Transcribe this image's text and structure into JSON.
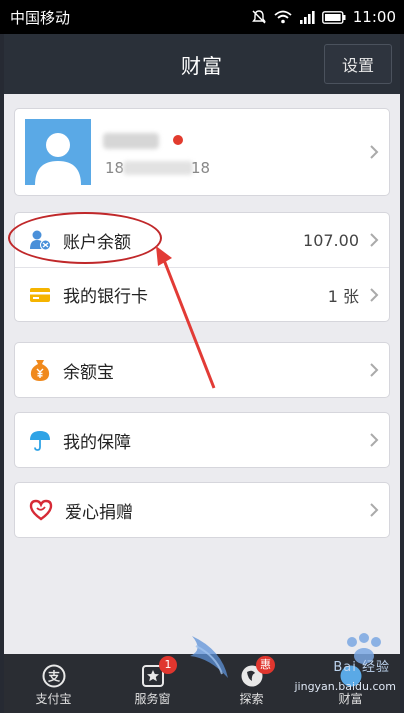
{
  "status_bar": {
    "carrier": "中国移动",
    "time": "11:00"
  },
  "header": {
    "title": "财富",
    "settings_label": "设置"
  },
  "profile": {
    "phone_prefix": "18",
    "phone_suffix": "18"
  },
  "account_card": {
    "items": [
      {
        "label": "账户余额",
        "value": "107.00",
        "icon": "account-balance-icon"
      },
      {
        "label": "我的银行卡",
        "value": "1 张",
        "icon": "bank-card-icon"
      }
    ]
  },
  "single_items": [
    {
      "label": "余额宝",
      "icon": "yuebao-money-bag-icon"
    },
    {
      "label": "我的保障",
      "icon": "umbrella-icon"
    },
    {
      "label": "爱心捐赠",
      "icon": "heart-icon"
    }
  ],
  "tab_bar": {
    "tabs": [
      {
        "label": "支付宝",
        "icon": "alipay-icon"
      },
      {
        "label": "服务窗",
        "icon": "service-window-icon",
        "badge": "1"
      },
      {
        "label": "探索",
        "icon": "explore-icon",
        "badge": "惠"
      },
      {
        "label": "财富",
        "icon": "wealth-icon"
      }
    ]
  },
  "watermark": {
    "text": "Bai 经验",
    "domain": "jingyan.baidu.com"
  },
  "colors": {
    "accent_blue": "#5aa9e6",
    "title_bar": "#2a3039",
    "annotation_red": "#c0282a",
    "badge_red": "#e0362e",
    "yuebao_orange": "#f0891c",
    "card_yellow": "#f5b400"
  }
}
